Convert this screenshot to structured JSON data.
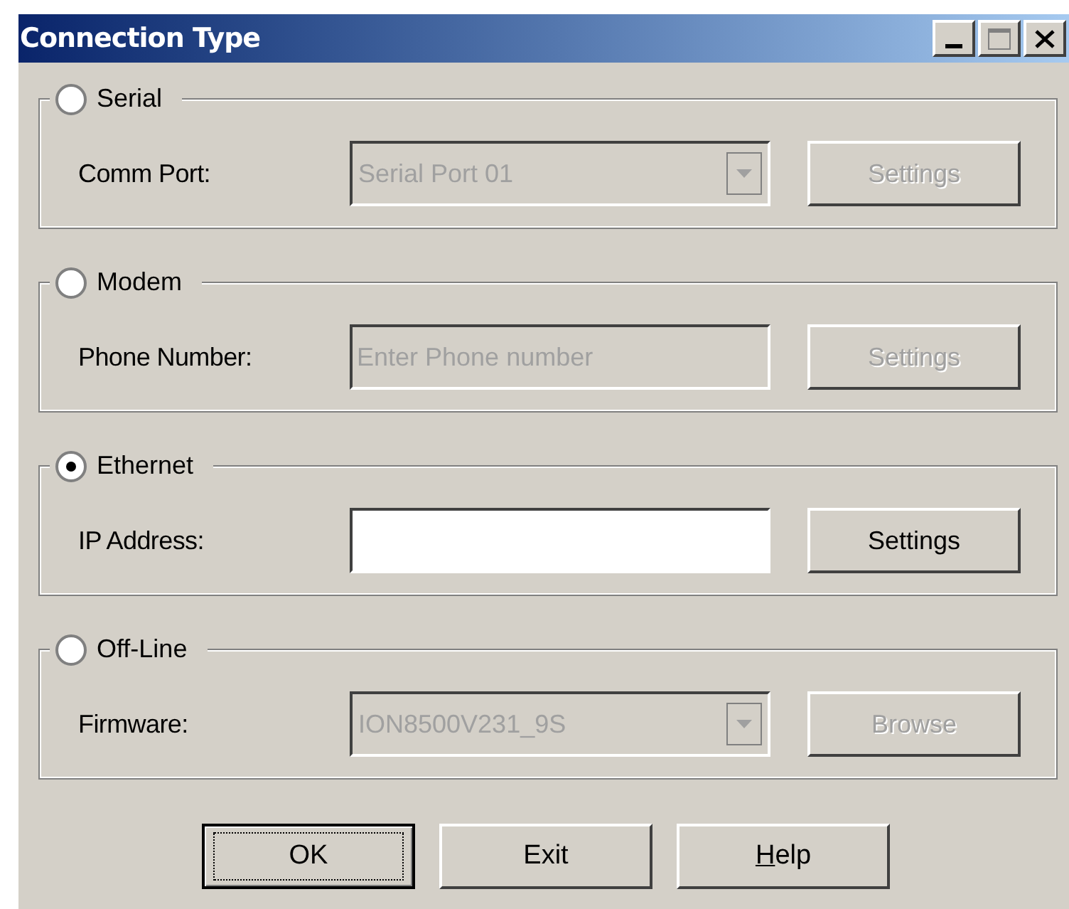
{
  "window": {
    "title": "Connection Type"
  },
  "groups": [
    {
      "label": "Serial",
      "selected": false,
      "field_label": "Comm Port:",
      "field": {
        "kind": "dropdown",
        "value": "Serial Port 01",
        "disabled": true
      },
      "button": {
        "label": "Settings",
        "disabled": true
      }
    },
    {
      "label": "Modem",
      "selected": false,
      "field_label": "Phone Number:",
      "field": {
        "kind": "text",
        "placeholder": "Enter Phone number",
        "disabled": true
      },
      "button": {
        "label": "Settings",
        "disabled": true
      }
    },
    {
      "label": "Ethernet",
      "selected": true,
      "field_label": "IP Address:",
      "field": {
        "kind": "text",
        "disabled": false
      },
      "button": {
        "label": "Settings",
        "disabled": false
      }
    },
    {
      "label": "Off-Line",
      "selected": false,
      "field_label": "Firmware:",
      "field": {
        "kind": "dropdown",
        "value": "ION8500V231_9S",
        "disabled": true
      },
      "button": {
        "label": "Browse",
        "disabled": true
      }
    }
  ],
  "buttons": [
    {
      "label": "OK",
      "default": true,
      "underline_first": false
    },
    {
      "label": "Exit",
      "default": false,
      "underline_first": false
    },
    {
      "label": "Help",
      "default": false,
      "underline_first": true
    }
  ]
}
